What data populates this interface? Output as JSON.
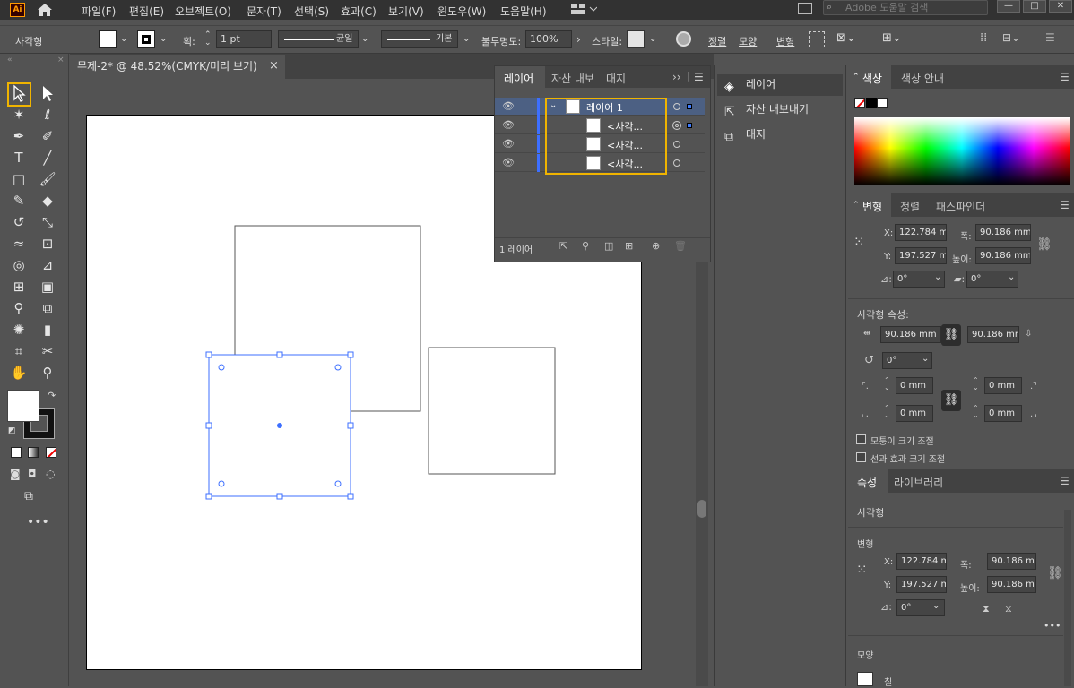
{
  "app": {
    "logo": "Ai",
    "menu": [
      "파일(F)",
      "편집(E)",
      "오브젝트(O)",
      "문자(T)",
      "선택(S)",
      "효과(C)",
      "보기(V)",
      "윈도우(W)",
      "도움말(H)"
    ],
    "search_placeholder": "Adobe 도움말 검색"
  },
  "control_bar": {
    "object_type": "사각형",
    "stroke_label": "획:",
    "stroke_weight": "1 pt",
    "profile_label": "균일",
    "brush_label": "기본",
    "opacity_label": "불투명도:",
    "opacity_value": "100%",
    "style_label": "스타일:",
    "align_label": "정렬",
    "shape_label": "모양",
    "transform_label": "변형"
  },
  "document": {
    "tab_title": "무제-2* @ 48.52%(CMYK/미리 보기)"
  },
  "layers_panel": {
    "tabs": [
      "레이어",
      "자산 내보",
      "대지"
    ],
    "layer_name": "레이어 1",
    "sublayers": [
      "<사각...",
      "<사각...",
      "<사각..."
    ],
    "footer_count": "1 레이어"
  },
  "collapsed_panel": {
    "items": [
      "레이어",
      "자산 내보내기",
      "대지"
    ]
  },
  "color_panel": {
    "tabs": [
      "색상",
      "색상 안내"
    ]
  },
  "transform_panel": {
    "tabs": [
      "변형",
      "정렬",
      "패스파인더"
    ],
    "x_label": "X:",
    "x_value": "122.784 m",
    "y_label": "Y:",
    "y_value": "197.527 m",
    "w_label": "폭:",
    "w_value": "90.186 mm",
    "h_label": "높이:",
    "h_value": "90.186 mm",
    "rotate_value": "0°",
    "shear_value": "0°",
    "rect_props_label": "사각형 속성:",
    "rect_w": "90.186 mm",
    "rect_h": "90.186 mm",
    "rect_rotate": "0°",
    "corner_tl": "0 mm",
    "corner_tr": "0 mm",
    "corner_bl": "0 mm",
    "corner_br": "0 mm",
    "scale_corners": "모퉁이 크기 조절",
    "scale_strokes": "선과 효과 크기 조절"
  },
  "properties_panel": {
    "tabs": [
      "속성",
      "라이브러리"
    ],
    "object_type": "사각형",
    "transform_heading": "변형",
    "x_value": "122.784 m",
    "y_value": "197.527 m",
    "w_value": "90.186 mi",
    "h_value": "90.186 mi",
    "rotate_value": "0°",
    "appearance_heading": "모양",
    "fill_label": "칠"
  },
  "colors": {
    "highlight": "#f0b400",
    "selection": "#3d6fff",
    "panel_bg": "#535353",
    "dark_bg": "#323232"
  }
}
